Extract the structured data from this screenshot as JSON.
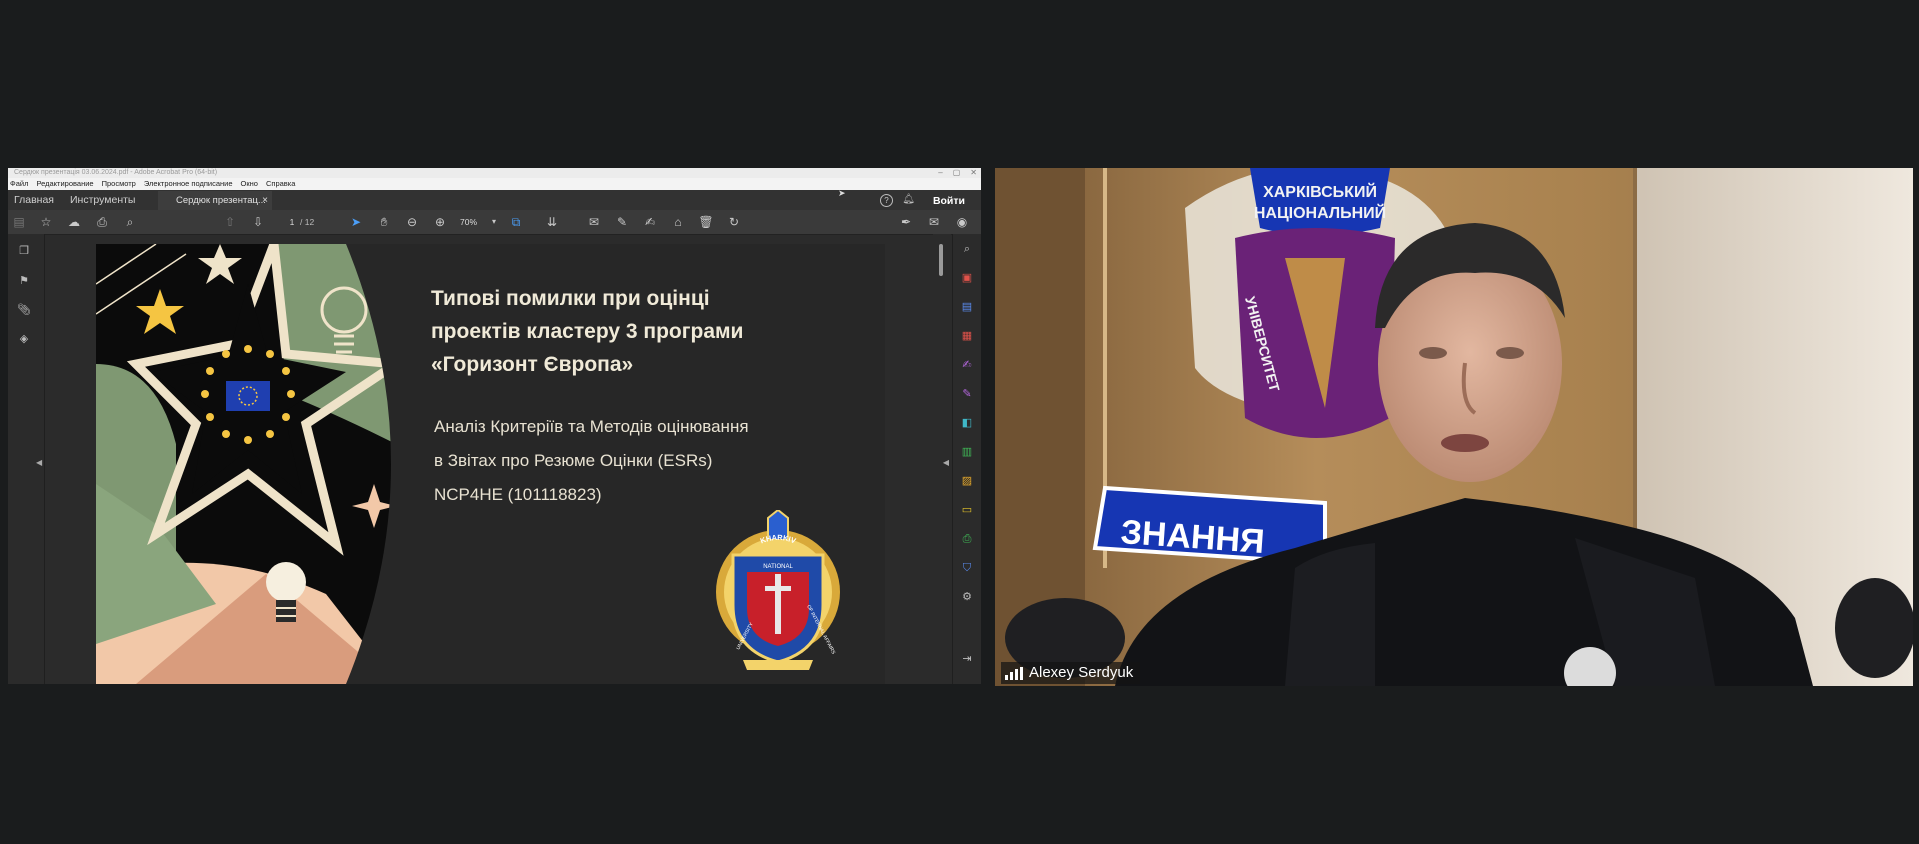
{
  "acrobat": {
    "window_title": "Сердюк презентація 03.06.2024.pdf - Adobe Acrobat Pro (64-bit)",
    "menu": [
      "Файл",
      "Редактирование",
      "Просмотр",
      "Электронное подписание",
      "Окно",
      "Справка"
    ],
    "tabs": {
      "home": "Главная",
      "tools": "Инструменты",
      "doc": "Сердюк презентац...",
      "doc_close": "×"
    },
    "login_label": "Войти",
    "page_current": "1",
    "page_total": "/ 12",
    "zoom": "70%"
  },
  "slide": {
    "title_lines": [
      "Типові помилки при оцінці",
      "проектів кластеру 3 програми",
      "«Горизонт Європа»"
    ],
    "subtitle_lines": [
      "Аналіз Критеріїв та Методів оцінювання",
      "в Звітах про Резюме Оцінки (ESRs)"
    ],
    "code": "NCP4HE (101118823)",
    "logo_text": {
      "arc_top": "KHARKIV",
      "arc_mid": "NATIONAL",
      "left": "UNIVERSITY",
      "right": "OF INTERNAL AFFAIRS"
    }
  },
  "video": {
    "participant_name": "Alexey Serdyuk",
    "emblem_text": {
      "line1": "ХАРКІВСЬКИЙ",
      "line2": "НАЦІОНАЛЬНИЙ",
      "side": "УНІВЕРСИТЕТ",
      "banner": "ЗНАННЯ"
    }
  },
  "colors": {
    "background": "#1a1c1d",
    "accent_blue": "#4b9ef7",
    "slide_text": "#f0ead8",
    "sage": "#7f9872"
  }
}
